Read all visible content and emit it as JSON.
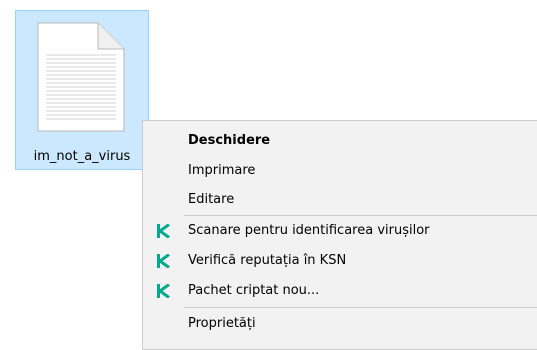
{
  "file": {
    "name": "im_not_a_virus",
    "icon": "text-file-icon"
  },
  "context_menu": {
    "items": [
      {
        "label": "Deschidere",
        "bold": true,
        "icon": ""
      },
      {
        "label": "Imprimare",
        "bold": false,
        "icon": ""
      },
      {
        "label": "Editare",
        "bold": false,
        "icon": ""
      },
      {
        "label": "Scanare pentru identificarea virușilor",
        "bold": false,
        "icon": "kaspersky-k-icon"
      },
      {
        "label": "Verifică reputația în KSN",
        "bold": false,
        "icon": "kaspersky-k-icon"
      },
      {
        "label": "Pachet criptat nou...",
        "bold": false,
        "icon": "kaspersky-k-icon"
      },
      {
        "label": "Proprietăți",
        "bold": false,
        "icon": ""
      }
    ]
  },
  "colors": {
    "selection_bg": "#cce8ff",
    "menu_bg": "#f2f2f2",
    "kaspersky_green": "#00a88e"
  }
}
